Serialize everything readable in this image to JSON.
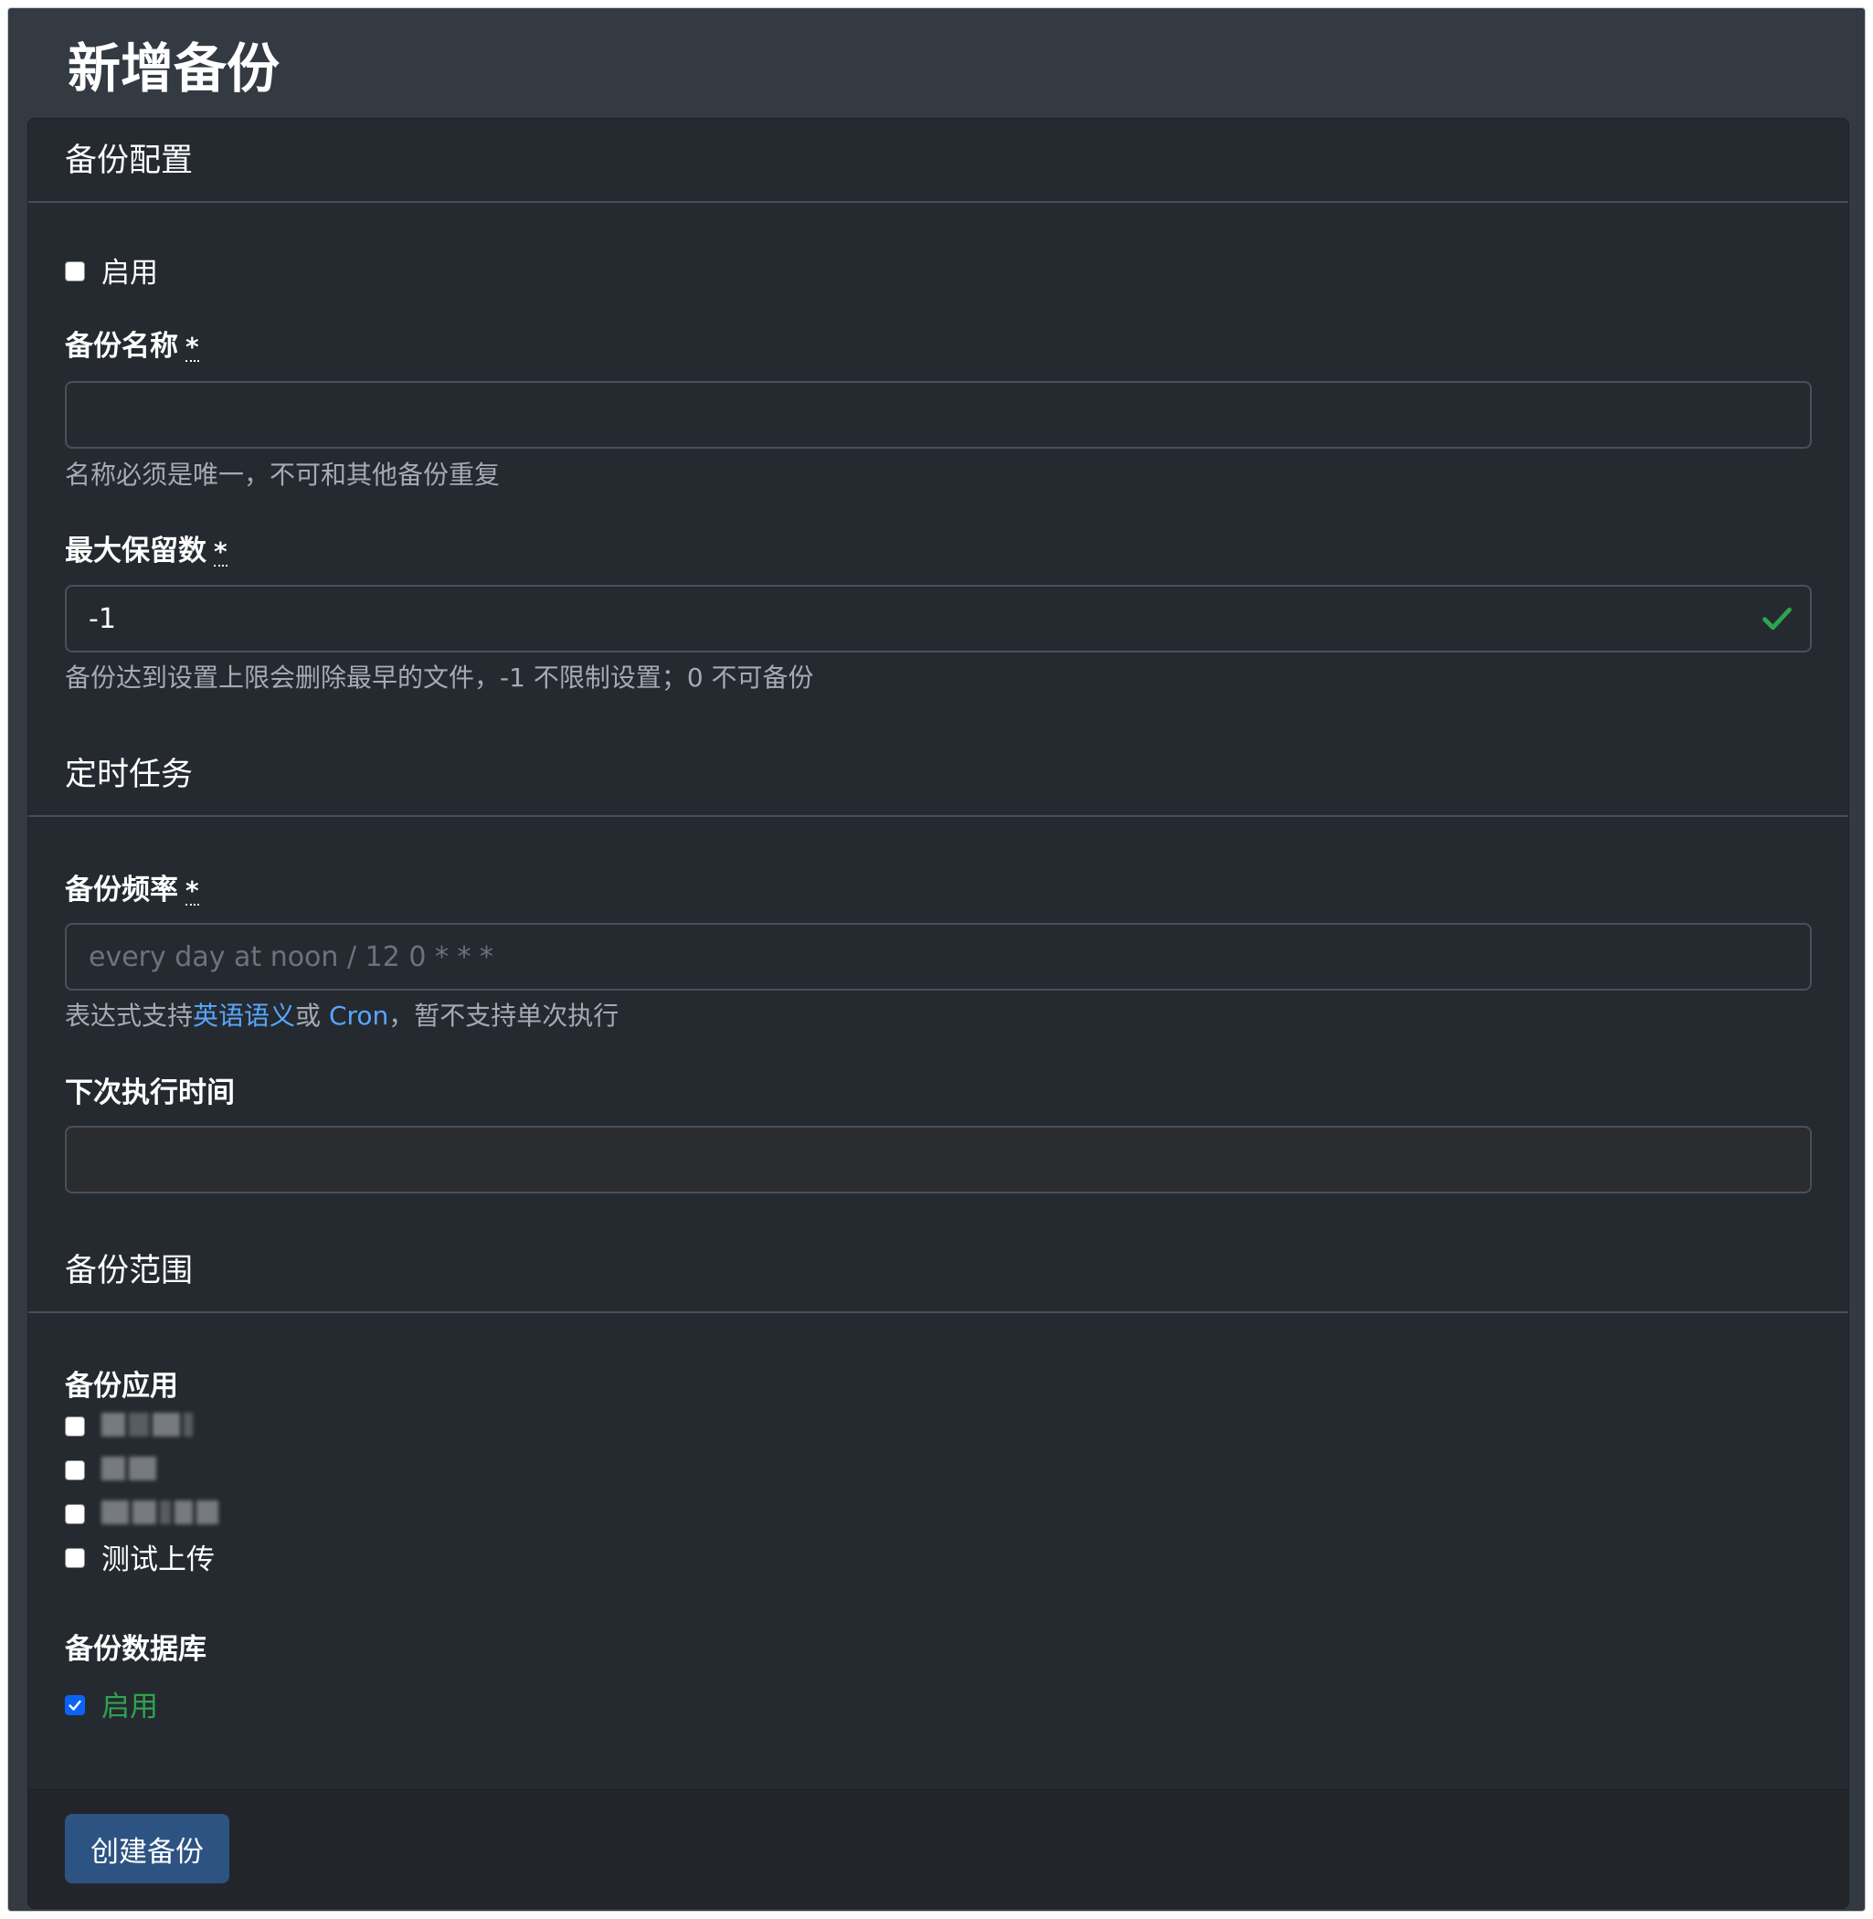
{
  "page": {
    "title": "新增备份"
  },
  "sections": {
    "config": "备份配置",
    "schedule": "定时任务",
    "scope": "备份范围"
  },
  "config": {
    "enable_label": "启用",
    "name": {
      "label": "备份名称",
      "required_mark": "*",
      "value": "",
      "placeholder": "",
      "help": "名称必须是唯一，不可和其他备份重复"
    },
    "max_keep": {
      "label": "最大保留数",
      "required_mark": "*",
      "value": "-1",
      "help": "备份达到设置上限会删除最早的文件，-1 不限制设置；0 不可备份"
    }
  },
  "schedule": {
    "frequency": {
      "label": "备份频率",
      "required_mark": "*",
      "value": "",
      "placeholder": "every day at noon / 12 0 * * *",
      "help_prefix": "表达式支持",
      "help_link1": "英语语义",
      "help_mid": "或 ",
      "help_link2": "Cron",
      "help_suffix": "，暂不支持单次执行"
    },
    "next_run": {
      "label": "下次执行时间",
      "value": ""
    }
  },
  "scope": {
    "apps_label": "备份应用",
    "apps": [
      {
        "label": "",
        "checked": false,
        "redacted": true
      },
      {
        "label": "",
        "checked": false,
        "redacted": true
      },
      {
        "label": "",
        "checked": false,
        "redacted": true
      },
      {
        "label": "测试上传",
        "checked": false,
        "redacted": false
      }
    ],
    "db_label": "备份数据库",
    "db_enable_label": "启用",
    "db_checked": true
  },
  "footer": {
    "submit_label": "创建备份"
  },
  "colors": {
    "background": "#343a42",
    "card": "#252a30",
    "primary": "#2c5382",
    "success": "#2ea44f",
    "link": "#58a6ff",
    "checkbox_checked": "#0b63f6"
  }
}
